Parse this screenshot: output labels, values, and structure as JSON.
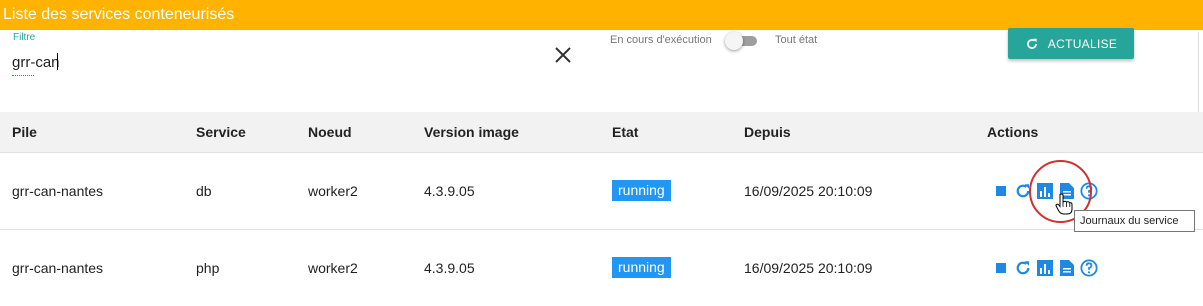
{
  "banner": {
    "title": "Liste des services conteneurisés"
  },
  "filter": {
    "label": "Filtre",
    "value": "grr-can"
  },
  "status_switch": {
    "left_label": "En cours d'exécution",
    "right_label": "Tout état",
    "state": "off"
  },
  "refresh_button": {
    "label": "ACTUALISE",
    "icon": "refresh-icon"
  },
  "table": {
    "headers": [
      "Pile",
      "Service",
      "Noeud",
      "Version image",
      "Etat",
      "Depuis",
      "Actions"
    ],
    "rows": [
      {
        "pile": "grr-can-nantes",
        "service": "db",
        "noeud": "worker2",
        "version": "4.3.9.05",
        "etat": "running",
        "depuis": "16/09/2025 20:10:09"
      },
      {
        "pile": "grr-can-nantes",
        "service": "php",
        "noeud": "worker2",
        "version": "4.3.9.05",
        "etat": "running",
        "depuis": "16/09/2025 20:10:09"
      }
    ],
    "action_icons": [
      "stop-icon",
      "restart-icon",
      "stats-icon",
      "logs-icon",
      "help-icon"
    ]
  },
  "tooltip": {
    "text": "Journaux du service"
  },
  "colors": {
    "banner": "#ffb300",
    "accent": "#26a69a",
    "badge": "#2196f3",
    "icon": "#1e88e5",
    "highlight": "#d32f2f"
  }
}
